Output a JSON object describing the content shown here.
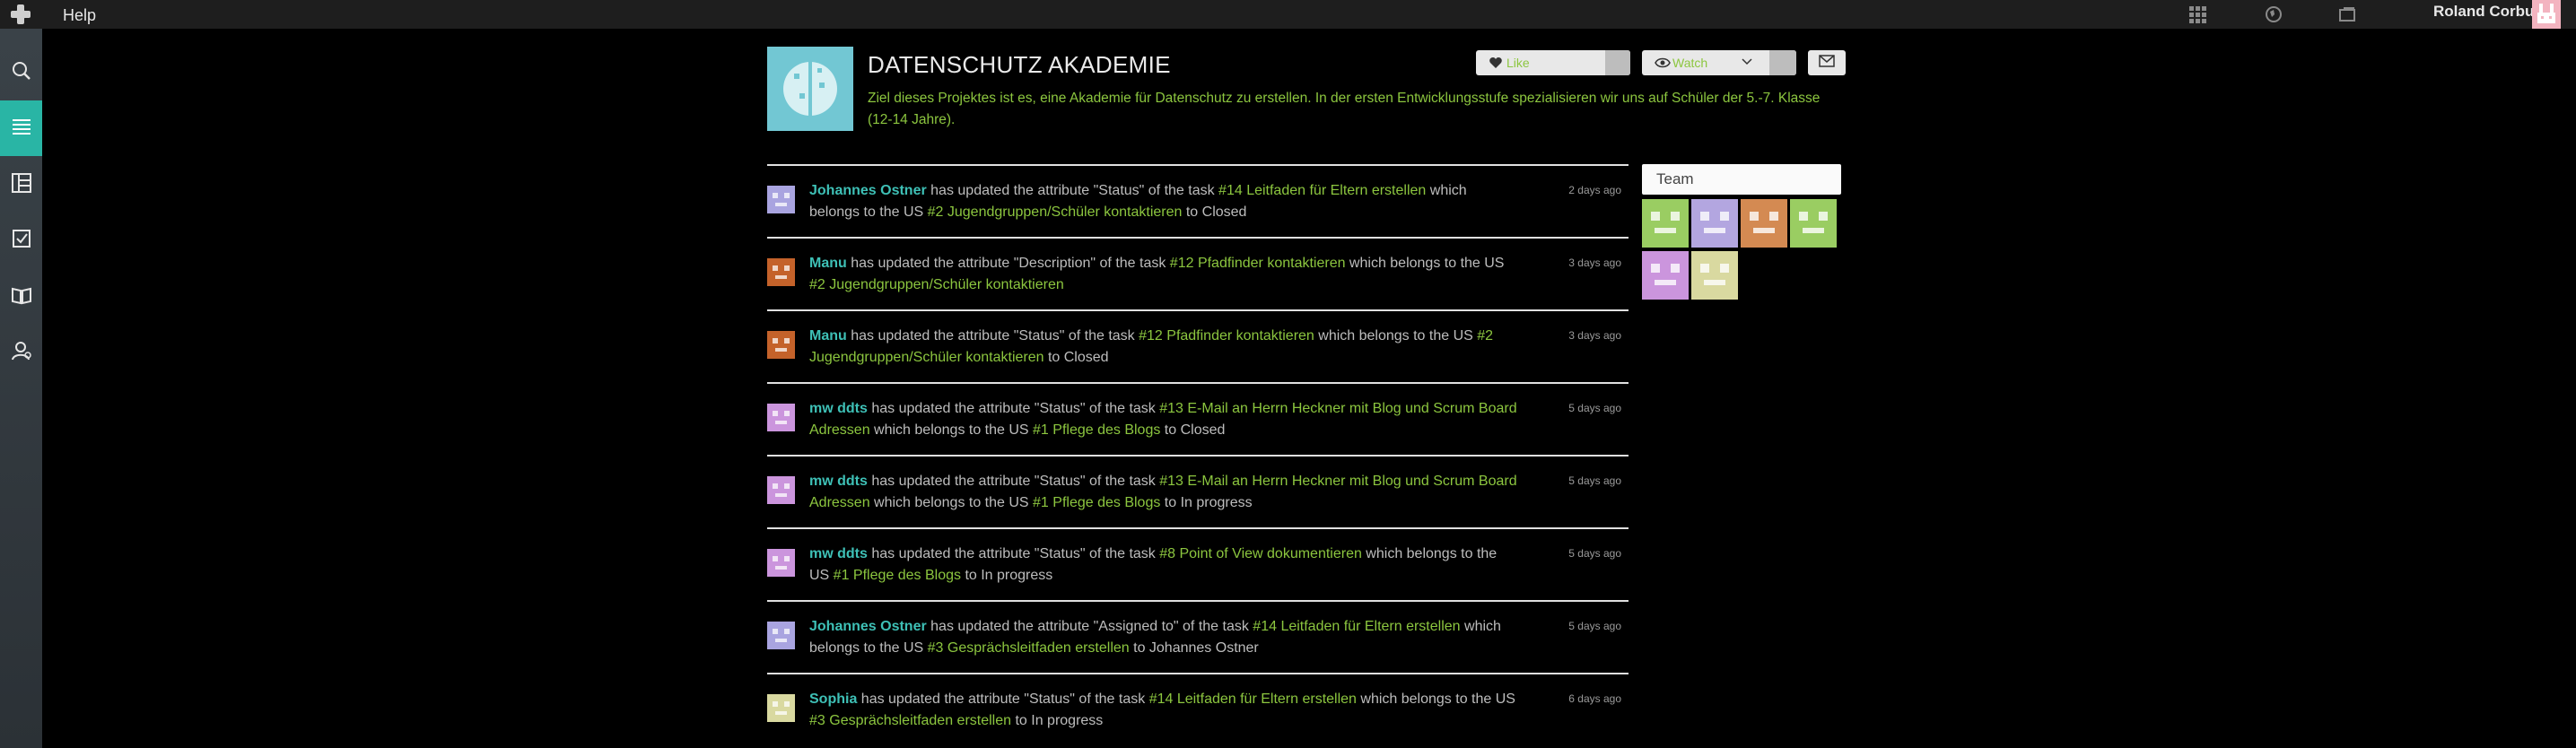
{
  "topbar": {
    "help": "Help",
    "user_name": "Roland Corbu",
    "icons": [
      "projects-grid-icon",
      "globe-icon",
      "notifications-icon"
    ]
  },
  "sidebar": {
    "items": [
      {
        "name": "search-icon",
        "active": false
      },
      {
        "name": "timeline-icon",
        "active": true
      },
      {
        "name": "backlog-icon",
        "active": false
      },
      {
        "name": "issues-icon",
        "active": false
      },
      {
        "name": "wiki-icon",
        "active": false
      },
      {
        "name": "team-icon",
        "active": false
      }
    ]
  },
  "project": {
    "title": "DATENSCHUTZ AKADEMIE",
    "description": "Ziel dieses Projektes ist es, eine Akademie für Datenschutz zu erstellen. In der ersten Entwicklungsstufe spezialisieren wir uns auf Schüler der 5.-7. Klasse (12-14 Jahre).",
    "like_label": "Like",
    "watch_label": "Watch"
  },
  "team": {
    "title": "Team",
    "members": [
      {
        "color": "#9acd62"
      },
      {
        "color": "#b3a6e0"
      },
      {
        "color": "#d48a52"
      },
      {
        "color": "#9acd62"
      },
      {
        "color": "#cb95dd"
      },
      {
        "color": "#d9d9a0"
      }
    ]
  },
  "timeline": [
    {
      "user": "Johannes Ostner",
      "avatar_color": "#a9a4e0",
      "pre": " has updated the attribute \"Status\" of the task ",
      "task": "#14 Leitfaden für Eltern erstellen",
      "mid": " which belongs to the US ",
      "us": "#2 Jugendgruppen/Schüler kontaktieren",
      "post": " to Closed",
      "ago": "2 days ago"
    },
    {
      "user": "Manu",
      "avatar_color": "#c4622a",
      "pre": " has updated the attribute \"Description\" of the task ",
      "task": "#12 Pfadfinder kontaktieren",
      "mid": " which belongs to the US ",
      "us": "#2 Jugendgruppen/Schüler kontaktieren",
      "post": "",
      "ago": "3 days ago"
    },
    {
      "user": "Manu",
      "avatar_color": "#c4622a",
      "pre": " has updated the attribute \"Status\" of the task ",
      "task": "#12 Pfadfinder kontaktieren",
      "mid": " which belongs to the US ",
      "us": "#2 Jugendgruppen/Schüler kontaktieren",
      "post": " to Closed",
      "ago": "3 days ago"
    },
    {
      "user": "mw ddts",
      "avatar_color": "#cb95dd",
      "pre": " has updated the attribute \"Status\" of the task ",
      "task": "#13 E-Mail an Herrn Heckner mit Blog und Scrum Board Adressen",
      "mid": " which belongs to the US ",
      "us": "#1 Pflege des Blogs",
      "post": " to Closed",
      "ago": "5 days ago"
    },
    {
      "user": "mw ddts",
      "avatar_color": "#cb95dd",
      "pre": " has updated the attribute \"Status\" of the task ",
      "task": "#13 E-Mail an Herrn Heckner mit Blog und Scrum Board Adressen",
      "mid": " which belongs to the US ",
      "us": "#1 Pflege des Blogs",
      "post": " to In progress",
      "ago": "5 days ago"
    },
    {
      "user": "mw ddts",
      "avatar_color": "#cb95dd",
      "pre": " has updated the attribute \"Status\" of the task ",
      "task": "#8 Point of View dokumentieren",
      "mid": " which belongs to the US ",
      "us": "#1 Pflege des Blogs",
      "post": " to In progress",
      "ago": "5 days ago"
    },
    {
      "user": "Johannes Ostner",
      "avatar_color": "#a9a4e0",
      "pre": " has updated the attribute \"Assigned to\" of the task ",
      "task": "#14 Leitfaden für Eltern erstellen",
      "mid": " which belongs to the US ",
      "us": "#3 Gesprächsleitfaden erstellen",
      "post": " to Johannes Ostner",
      "ago": "5 days ago"
    },
    {
      "user": "Sophia",
      "avatar_color": "#d9d9a0",
      "pre": " has updated the attribute \"Status\" of the task ",
      "task": "#14 Leitfaden für Eltern erstellen",
      "mid": " which belongs to the US ",
      "us": "#3 Gesprächsleitfaden erstellen",
      "post": " to In progress",
      "ago": "6 days ago"
    }
  ]
}
